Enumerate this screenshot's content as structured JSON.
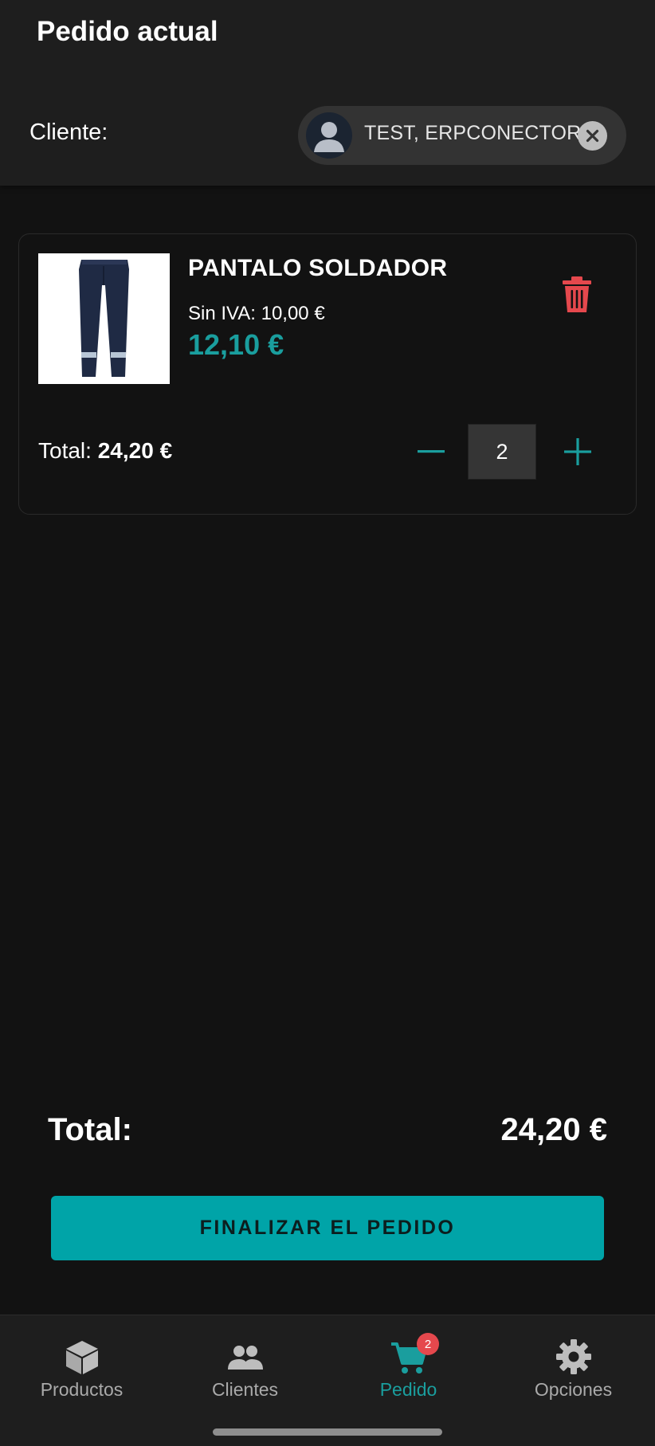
{
  "header": {
    "title": "Pedido actual",
    "client_label": "Cliente:",
    "client_name": "TEST, ERPCONECTOR",
    "avatar_icon": "person-icon",
    "clear_icon": "close-icon"
  },
  "order": {
    "items": [
      {
        "name": "PANTALO SOLDADOR",
        "price_without_vat": "Sin IVA: 10,00 €",
        "price_with_vat": "12,10 €",
        "total_label": "Total:",
        "total_value": "24,20 €",
        "quantity": "2",
        "delete_icon": "trash-icon",
        "decrement_icon": "minus-icon",
        "increment_icon": "plus-icon"
      }
    ]
  },
  "summary": {
    "total_label": "Total:",
    "total_value": "24,20 €",
    "finalize_label": "FINALIZAR EL PEDIDO"
  },
  "nav": {
    "items": [
      {
        "label": "Productos",
        "icon": "box-icon"
      },
      {
        "label": "Clientes",
        "icon": "users-icon"
      },
      {
        "label": "Pedido",
        "icon": "cart-icon",
        "badge": "2",
        "active": true
      },
      {
        "label": "Opciones",
        "icon": "gear-icon"
      }
    ]
  },
  "colors": {
    "accent": "#1a9e9e",
    "button": "#00a4a8",
    "danger": "#e5484d",
    "background": "#121212",
    "surface": "#1e1e1e"
  }
}
